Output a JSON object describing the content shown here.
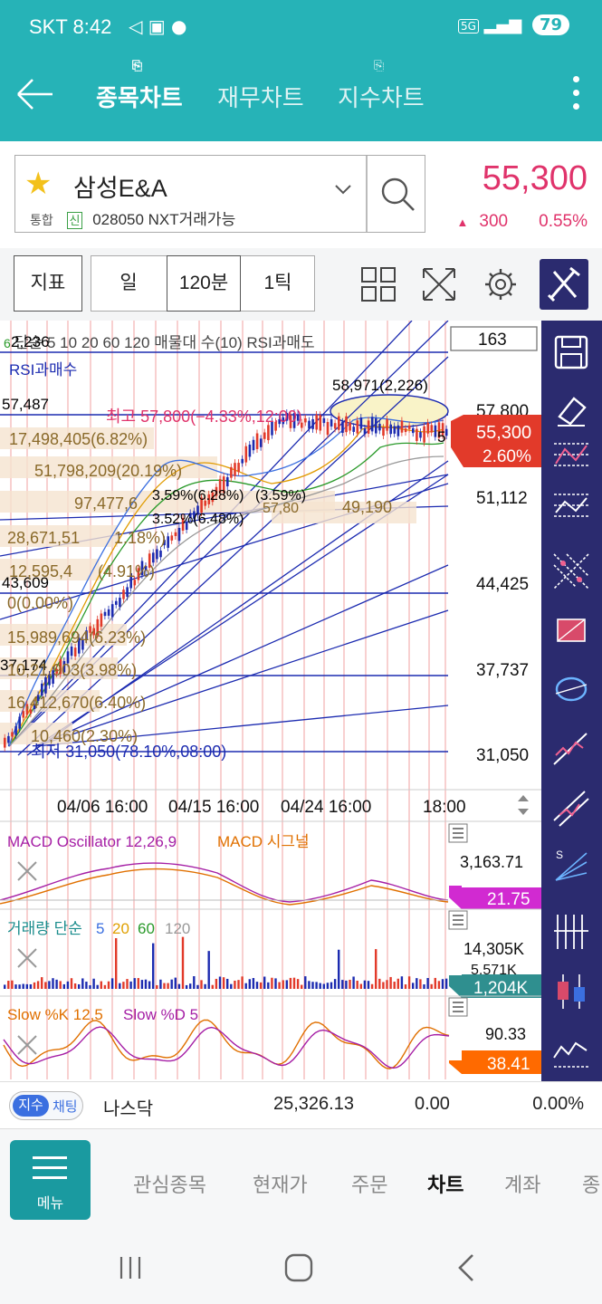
{
  "status_bar": {
    "carrier": "SKT",
    "time": "8:42",
    "icons": "◁ ▣ ●",
    "network": "5G",
    "battery": "79"
  },
  "nav": {
    "tabs": [
      {
        "label": "종목차트"
      },
      {
        "label": "재무차트"
      },
      {
        "label": "지수차트"
      }
    ]
  },
  "stock": {
    "name": "삼성E&A",
    "market": "통합",
    "badge": "신",
    "code_text": "028050 NXT거래가능",
    "price": "55,300",
    "change": "300",
    "change_pct": "0.55%"
  },
  "toolbar": {
    "indicator_label": "지표",
    "period_day": "일",
    "period_min": "120분",
    "period_tick": "1틱"
  },
  "chart": {
    "legend": "단순 5 10 20 60 120 매물대 수(10) RSI과매도",
    "legend_colors": [
      "#222",
      "#3b6fe0",
      "#e0a000",
      "#2a9a2a",
      "#999",
      "#333",
      "#e0336b"
    ],
    "rsi_over": "RSI과매수",
    "price_box": "163",
    "right_axis": [
      "57,800",
      "51,112",
      "44,425",
      "37,737",
      "31,050"
    ],
    "current_price": "55,300",
    "current_pct": "2.60%",
    "left_labels": [
      "2,236",
      "57,487",
      "43,609",
      "37,174"
    ],
    "high_label": "최고 57,800(−4.33%,12:00)",
    "peak_label": "58,971(2,226)",
    "low_label": "최저 31,050(78.10%,08:00)",
    "volume_profile": [
      "17,498,405(6.82%)",
      "51,798,209(20.19%)",
      "97,477,6",
      "28,671,51",
      "12,595,4",
      "0(0.00%)",
      "15,989,694(6.23%)",
      "10,21,903(3.98%)",
      "16,412,670(6.40%)",
      "10,460(2.30%)"
    ],
    "vp_partial": [
      "1.18%)",
      "(4.91%)"
    ],
    "misc_labels": [
      "3.59%(6.28%)",
      "(3.59%)",
      "3.52%(6.48%)",
      "49,190",
      "57,80",
      "5"
    ],
    "time_labels": [
      "04/06 16:00",
      "04/15 16:00",
      "04/24 16:00",
      "18:00"
    ],
    "macd": {
      "title1": "MACD Oscillator 12,26,9",
      "title2": "MACD 시그널",
      "top": "3,163.71",
      "current": "21.75"
    },
    "volume": {
      "title": "거래량 단순",
      "mas": [
        "5",
        "20",
        "60",
        "120"
      ],
      "top": "14,305K",
      "mid": "5,571K",
      "current": "1,204K"
    },
    "stoch": {
      "title1": "Slow %K 12,5",
      "title2": "Slow %D 5",
      "top": "90.33",
      "current": "38.41"
    }
  },
  "index_bar": {
    "pill_a": "지수",
    "pill_b": "채팅",
    "name": "나스닥",
    "value": "25,326.13",
    "change": "0.00",
    "pct": "0.00%"
  },
  "bottom_nav": {
    "menu_label": "메뉴",
    "items": [
      "관심종목",
      "현재가",
      "주문",
      "차트",
      "계좌",
      "종"
    ]
  }
}
